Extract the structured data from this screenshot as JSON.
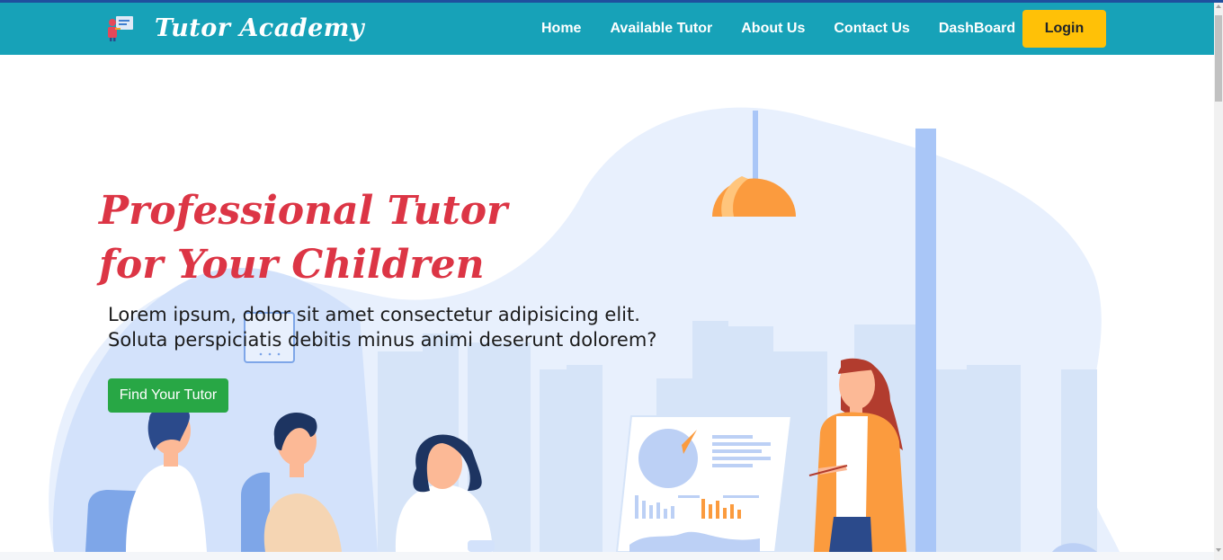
{
  "brand": {
    "name": "Tutor Academy",
    "logo_icon": "teacher-board-icon"
  },
  "nav": {
    "items": [
      {
        "label": "Home"
      },
      {
        "label": "Available Tutor"
      },
      {
        "label": "About Us"
      },
      {
        "label": "Contact Us"
      },
      {
        "label": "DashBoard"
      }
    ],
    "login_label": "Login"
  },
  "hero": {
    "title_line1": "Professional Tutor",
    "title_line2": "for Your Children",
    "subtitle_line1": "Lorem ipsum, dolor sit amet consectetur adipisicing elit.",
    "subtitle_line2": "Soluta perspiciatis debitis minus animi deserunt dolorem?",
    "cta_label": "Find Your Tutor",
    "illustration_icon": "classroom-illustration-icon"
  },
  "colors": {
    "navbar": "#17a2b8",
    "login": "#ffc107",
    "title": "#dc3545",
    "cta": "#28a745",
    "blob": "#e8f0fd"
  }
}
